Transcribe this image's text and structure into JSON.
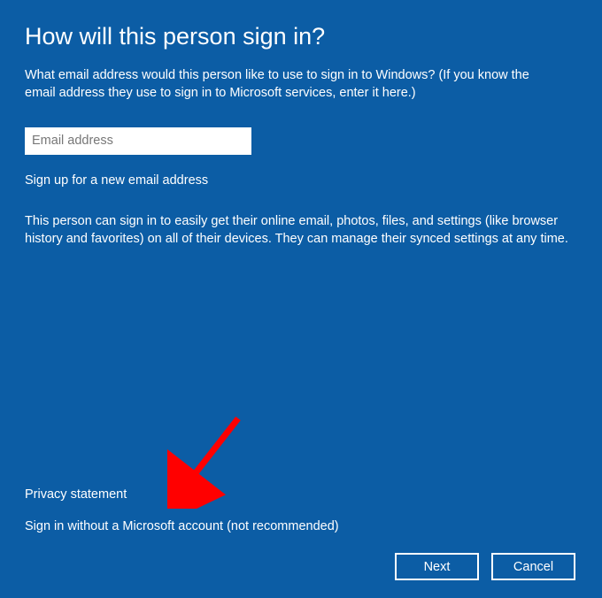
{
  "title": "How will this person sign in?",
  "instruction": "What email address would this person like to use to sign in to Windows? (If you know the email address they use to sign in to Microsoft services, enter it here.)",
  "email": {
    "placeholder": "Email address",
    "value": ""
  },
  "signup_link": "Sign up for a new email address",
  "benefits": "This person can sign in to easily get their online email, photos, files, and settings (like browser history and favorites) on all of their devices. They can manage their synced settings at any time.",
  "privacy_link": "Privacy statement",
  "no_account_link": "Sign in without a Microsoft account (not recommended)",
  "buttons": {
    "next": "Next",
    "cancel": "Cancel"
  }
}
